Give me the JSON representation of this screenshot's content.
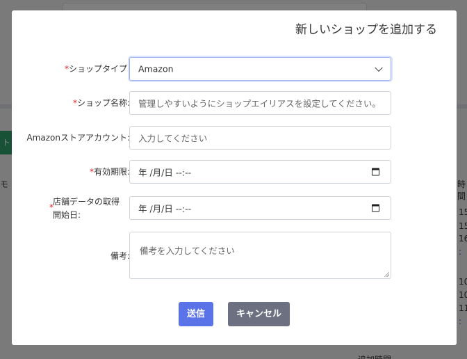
{
  "background": {
    "green_button_label": "ト",
    "left_fragments": [
      "モ"
    ],
    "right_header": "時間",
    "right_values": [
      "15",
      "15",
      "16",
      "10",
      "10",
      "11"
    ],
    "right_links": [
      ":",
      ":"
    ],
    "bottom_text": "追加時間"
  },
  "modal": {
    "title": "新しいショップを追加する",
    "fields": {
      "shop_type": {
        "required_mark": "*",
        "label": "ショップタイプ:",
        "value": "Amazon"
      },
      "shop_name": {
        "required_mark": "*",
        "label": "ショップ名称:",
        "placeholder": "管理しやすいようにショップエイリアスを設定してください。"
      },
      "store_account": {
        "label": "Amazonストアアカウント:",
        "placeholder": "入力してください"
      },
      "expiry": {
        "required_mark": "*",
        "label": "有効期限:",
        "value": "年 /月/日 --:--"
      },
      "start_date": {
        "required_mark": "*",
        "label_line1": "店舗データの取得",
        "label_line2": "開始日:",
        "value": "年 /月/日 --:--"
      },
      "note": {
        "label": "備考:",
        "placeholder": "備考を入力してください"
      }
    },
    "buttons": {
      "submit": "送信",
      "cancel": "キャンセル"
    }
  },
  "icons": {
    "select_arrow": "chevron-down-icon",
    "date_picker": "calendar-icon"
  }
}
